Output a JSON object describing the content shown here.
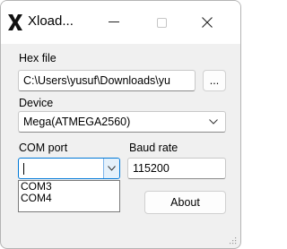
{
  "window": {
    "title": "Xload...",
    "minimize_symbol": "—",
    "maximize_symbol": "□",
    "close_symbol": "✕"
  },
  "hex_file": {
    "label": "Hex file",
    "value": "C:\\Users\\yusuf\\Downloads\\yu",
    "browse_label": "..."
  },
  "device": {
    "label": "Device",
    "selected": "Mega(ATMEGA2560)"
  },
  "com_port": {
    "label": "COM port",
    "value": "",
    "options": [
      "COM3",
      "COM4"
    ]
  },
  "baud_rate": {
    "label": "Baud rate",
    "value": "115200"
  },
  "buttons": {
    "about_label": "About"
  },
  "colors": {
    "window_bg": "#f0f0f0",
    "titlebar_bg": "#ffffff",
    "input_border": "#c8c8c8"
  }
}
